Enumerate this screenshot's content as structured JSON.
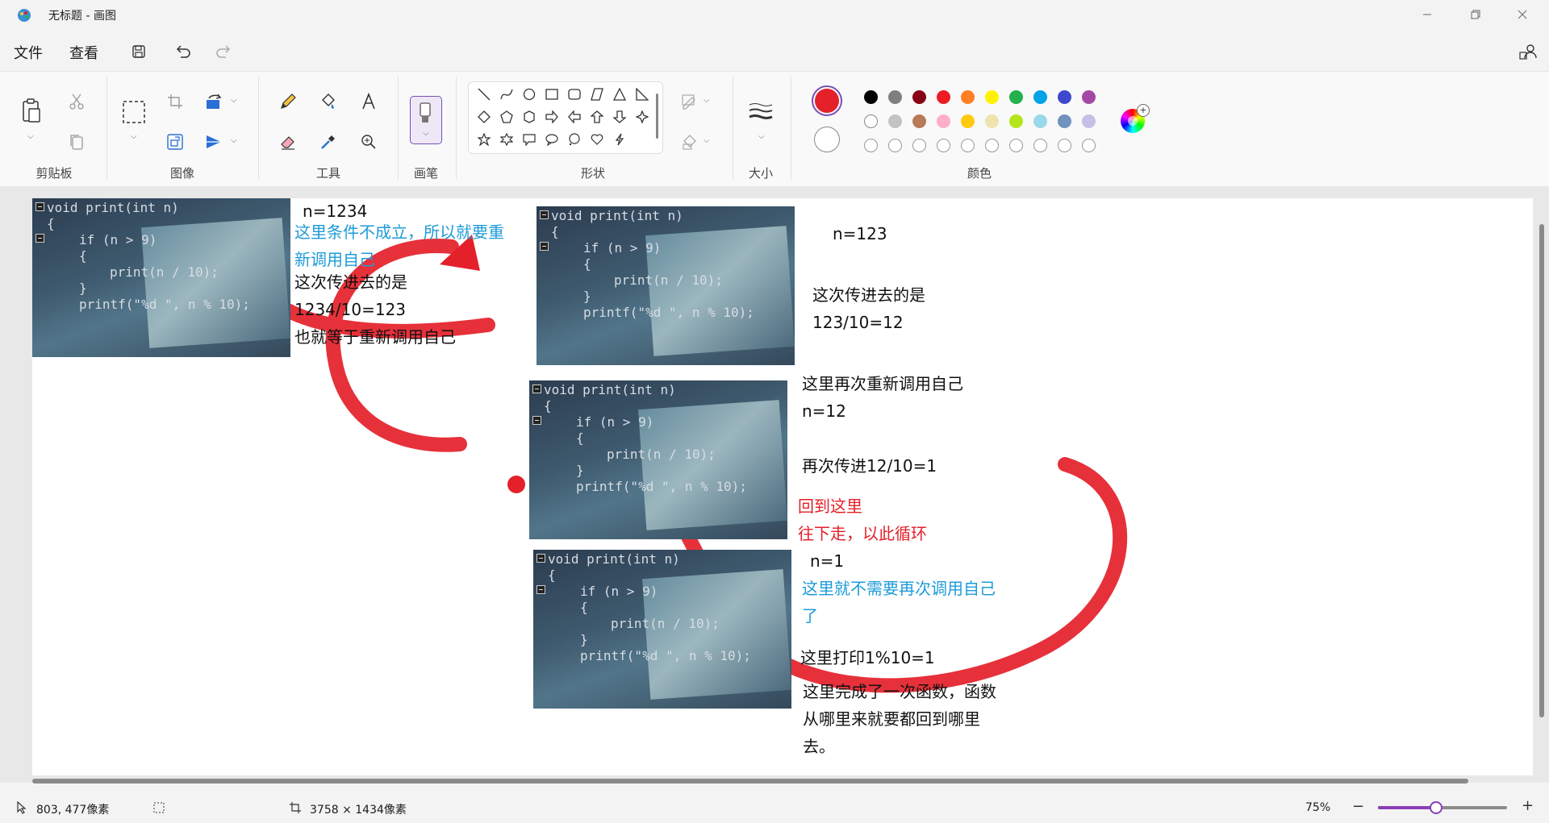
{
  "window": {
    "title": "无标题 - 画图"
  },
  "menu": {
    "file": "文件",
    "view": "查看"
  },
  "ribbon": {
    "groups": {
      "clipboard": "剪贴板",
      "image": "图像",
      "tools": "工具",
      "brushes": "画笔",
      "shapes": "形状",
      "size": "大小",
      "colors": "颜色"
    },
    "primary_color": "#e4202a",
    "secondary_color": "#ffffff",
    "palette_row1": [
      "#000000",
      "#7f7f7f",
      "#880015",
      "#ed1c24",
      "#ff7f27",
      "#fff200",
      "#22b14c",
      "#00a2e8",
      "#3f48cc",
      "#a349a4"
    ],
    "palette_row2": [
      "#ffffff",
      "#c3c3c3",
      "#b97a57",
      "#ffaec9",
      "#ffc90e",
      "#efe4b0",
      "#b5e61d",
      "#99d9ea",
      "#7092be",
      "#c8bfe7"
    ]
  },
  "canvas": {
    "code_line1": "void print(int n)",
    "code_line2": "{",
    "code_line3": "if (n > 9)",
    "code_line4": "{",
    "code_line5": "print(n / 10);",
    "code_line6": "}",
    "code_line7": "printf(\"%d \", n % 10);",
    "note_n1234": "n=1234",
    "note_cond1": "这里条件不成立，所以就要重",
    "note_cond2": "新调用自己",
    "note_pass1": "这次传进去的是",
    "note_pass2": "1234/10=123",
    "note_pass3": "也就等于重新调用自己",
    "note_n123": "n=123",
    "note_pass4": "这次传进去的是",
    "note_pass5": "123/10=12",
    "note_again1": "这里再次重新调用自己",
    "note_again2": "n=12",
    "note_again3": "再次传进12/10=1",
    "note_back1": "回到这里",
    "note_back2": "往下走，以此循环",
    "note_n1": "n=1",
    "note_noneed1": "这里就不需要再次调用自己",
    "note_noneed2": "了",
    "note_print": "这里打印1%10=1",
    "note_done1": "这里完成了一次函数，函数",
    "note_done2": "从哪里来就要都回到哪里",
    "note_done3": "去。"
  },
  "status": {
    "cursor": "803, 477像素",
    "canvas_size": "3758 × 1434像素",
    "zoom": "75%",
    "zoom_level": 0.45
  }
}
